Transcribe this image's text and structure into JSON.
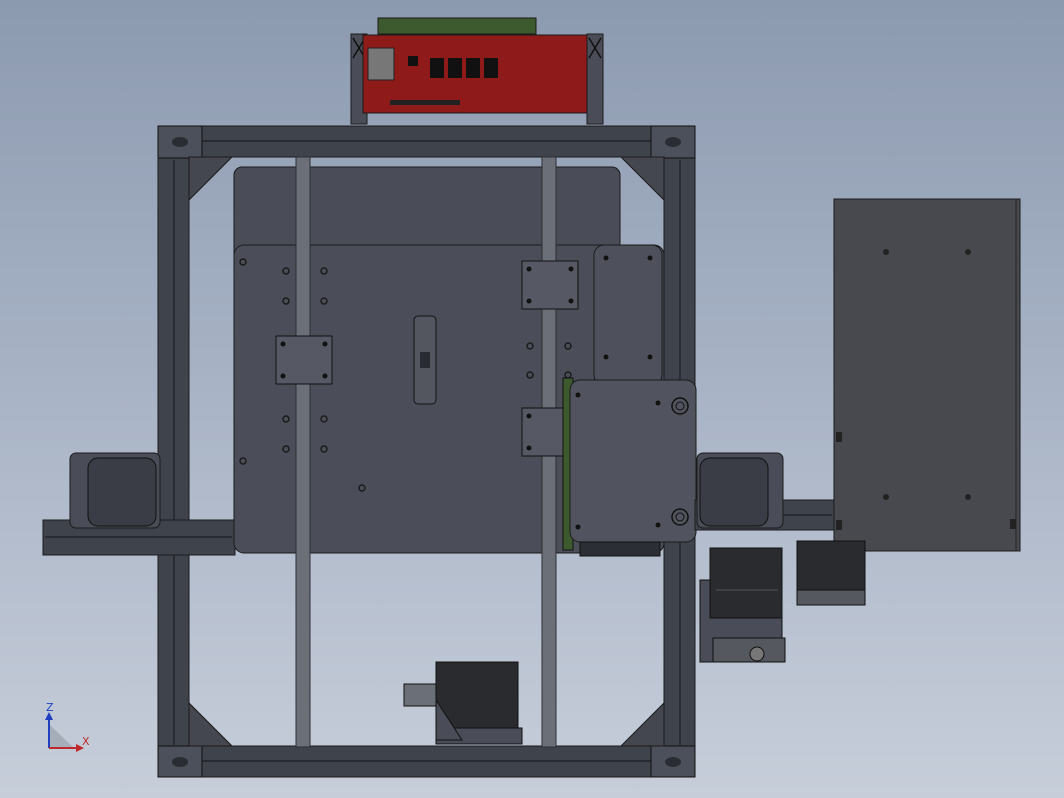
{
  "viewport": {
    "background": "#9aa6ba",
    "model": {
      "frame_color": "#3f434c",
      "panel_color": "#4a4d57",
      "board_color": "#8e1a1a",
      "motor_color": "#2a2b2f",
      "rod_color": "#6b6f78"
    },
    "triad": {
      "z_label": "Z",
      "x_label": "X",
      "z_color": "#1f3fbf",
      "x_color": "#c0292b"
    }
  }
}
